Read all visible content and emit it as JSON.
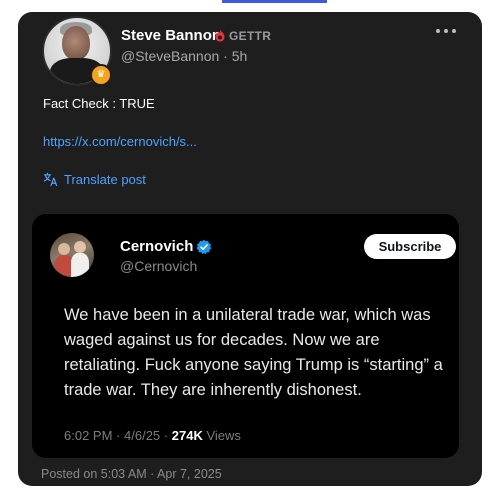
{
  "post": {
    "author_name": "Steve Bannon",
    "platform_label": "GETTR",
    "handle": "@SteveBannon",
    "time_sep": "·",
    "time_ago": "5h",
    "text": "Fact Check : TRUE",
    "link": "https://x.com/cernovich/s...",
    "translate_label": "Translate post",
    "posted_label": "Posted on 5:03 AM · Apr 7, 2025",
    "more_icon": "more-dots-icon",
    "badge_icon": "crown-badge-icon"
  },
  "quoted": {
    "author_name": "Cernovich",
    "handle": "@Cernovich",
    "subscribe_label": "Subscribe",
    "text": "We have been in a unilateral trade war, which was waged against us for decades. Now we are retaliating. Fuck anyone saying Trump is “starting” a trade war. They are inherently dishonest.",
    "time": "6:02 PM",
    "date": "4/6/25",
    "sep": "·",
    "views_count": "274K",
    "views_label": "Views"
  },
  "colors": {
    "card_bg": "#1e1e1e",
    "embed_bg": "#000000",
    "link": "#4da3ff",
    "gettr_red": "#e8323c",
    "verified_blue": "#1d9bf0",
    "badge_orange": "#f4a51c"
  }
}
